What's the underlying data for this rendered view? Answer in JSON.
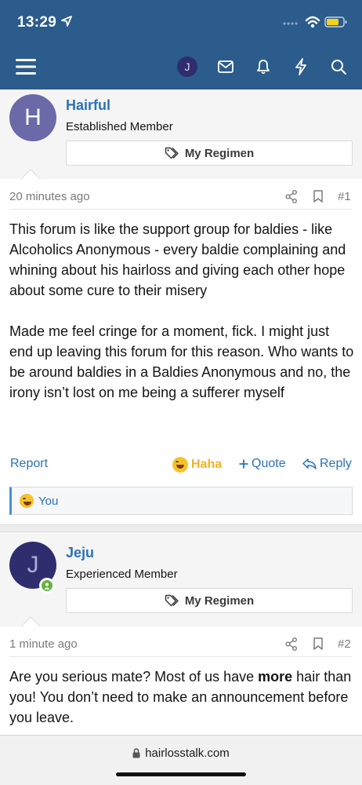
{
  "status": {
    "time": "13:29"
  },
  "nav": {
    "avatar_letter": "J"
  },
  "posts": [
    {
      "avatar_letter": "H",
      "username": "Hairful",
      "user_title": "Established Member",
      "regimen_label": "My Regimen",
      "time": "20 minutes ago",
      "number": "#1",
      "paragraphs": [
        "This forum is like the support group for baldies - like Alcoholics Anonymous - every baldie complaining and whining about his hairloss and giving each other hope about some cure to their misery",
        "Made me feel cringe for a moment, fick. I might just end up leaving this forum for this reason. Who wants to be around baldies in a Baldies Anonymous and no, the irony isn’t lost on me being a sufferer myself"
      ],
      "actions": {
        "report": "Report",
        "haha": "Haha",
        "quote": "Quote",
        "reply": "Reply"
      },
      "reactions_text": "You"
    },
    {
      "avatar_letter": "J",
      "username": "Jeju",
      "user_title": "Experienced Member",
      "regimen_label": "My Regimen",
      "time": "1 minute ago",
      "number": "#2",
      "text_before": "Are you serious mate? Most of us have ",
      "text_bold": "more",
      "text_after": " hair than you! You don’t need to make an announcement before you leave."
    }
  ],
  "browser": {
    "url": "hairlosstalk.com"
  },
  "colors": {
    "header": "#2b5c8c",
    "link": "#2b72b8",
    "avatar_h": "#6b69a8",
    "avatar_j": "#2f2d6e",
    "online": "#63b33d"
  },
  "icons": [
    "location-arrow-icon",
    "signal-icon",
    "wifi-icon",
    "battery-icon",
    "menu-icon",
    "envelope-icon",
    "bell-icon",
    "bolt-icon",
    "search-icon",
    "tag-icon",
    "share-icon",
    "bookmark-icon",
    "laugh-emoji-icon",
    "plus-icon",
    "reply-icon",
    "lock-icon"
  ]
}
